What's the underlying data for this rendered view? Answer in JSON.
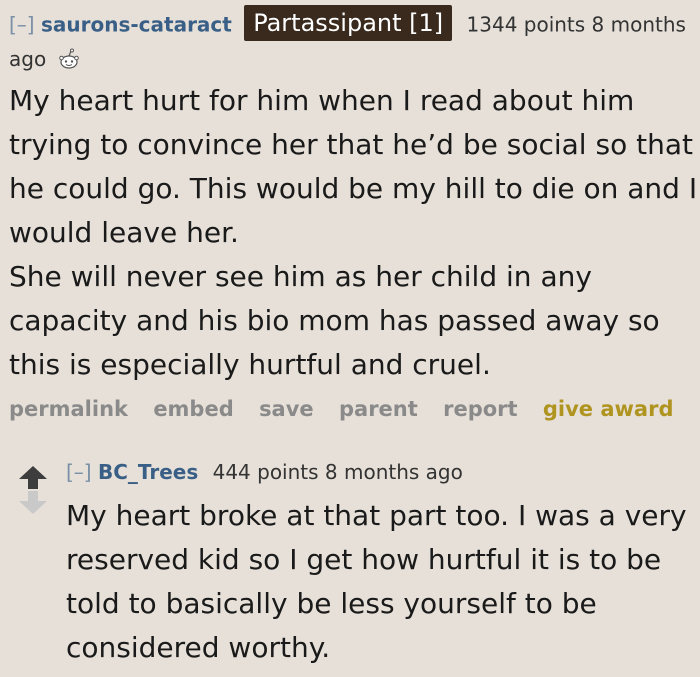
{
  "comment": {
    "expand_label": "[–]",
    "author": "saurons-cataract",
    "flair": "Partassipant [1]",
    "score_time": "1344 points 8 months ago",
    "icon": "snoo-award-icon",
    "paragraphs": [
      "My heart hurt for him when I read about him trying to convince her that he’d be social so that he could go. This would be my hill to die on and I would leave her.",
      "She will never see him as her child in any capacity and his bio mom has passed away so this is especially hurtful and cruel."
    ],
    "buttons": {
      "permalink": "permalink",
      "embed": "embed",
      "save": "save",
      "parent": "parent",
      "report": "report",
      "give_award": "give award"
    }
  },
  "reply": {
    "expand_label": "[–]",
    "author": "BC_Trees",
    "score_time": "444 points 8 months ago",
    "body": "My heart broke at that part too. I was a very reserved kid so I get how hurtful it is to be told to basically be less yourself to be considered worthy."
  },
  "colors": {
    "background": "#e6e0d8",
    "author": "#3a5f87",
    "flair_bg": "#3a2a1e",
    "award": "#b09420",
    "button": "#8a8a8a",
    "arrow_up": "#3d3d3d",
    "arrow_down": "#c9c9c9"
  }
}
